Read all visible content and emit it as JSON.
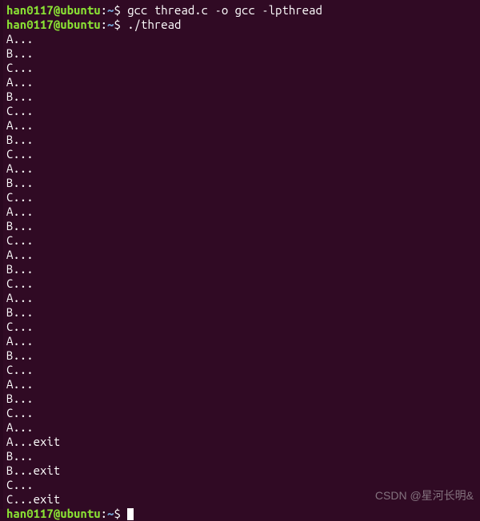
{
  "prompt": {
    "user": "han0117",
    "at": "@",
    "host": "ubuntu",
    "colon": ":",
    "path": "~",
    "dollar": "$ "
  },
  "commands": [
    "gcc thread.c -o gcc -lpthread",
    "./thread"
  ],
  "output_lines": [
    "A...",
    "B...",
    "C...",
    "A...",
    "B...",
    "C...",
    "A...",
    "B...",
    "C...",
    "A...",
    "B...",
    "C...",
    "A...",
    "B...",
    "C...",
    "A...",
    "B...",
    "C...",
    "A...",
    "B...",
    "C...",
    "A...",
    "B...",
    "C...",
    "A...",
    "B...",
    "C...",
    "A...",
    "A...exit",
    "B...",
    "B...exit",
    "C...",
    "C...exit"
  ],
  "watermark": "CSDN @星河长明&"
}
